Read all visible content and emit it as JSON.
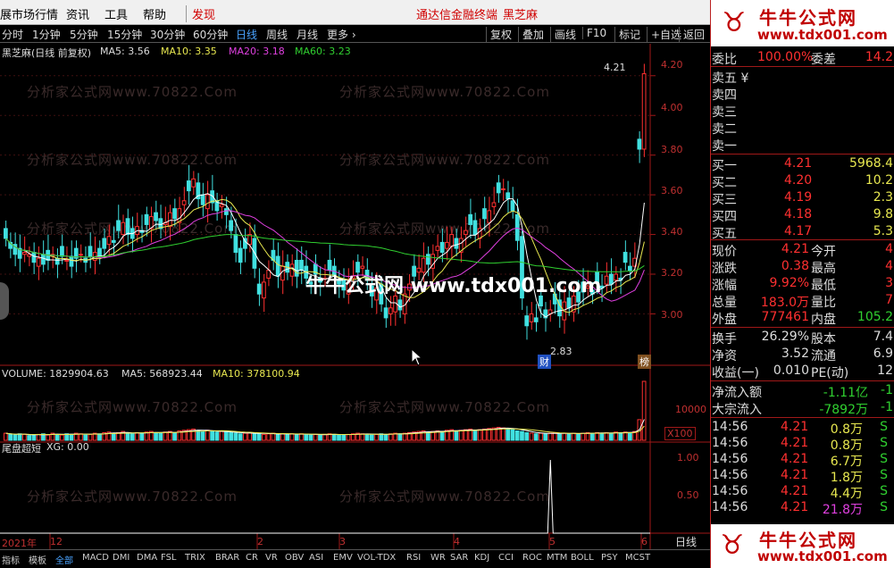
{
  "menu": {
    "items": [
      "展市场行情",
      "资讯",
      "工具",
      "帮助"
    ],
    "discover": "发现",
    "app_title": "通达信金融终端",
    "stock_name": "黑芝麻",
    "win_buttons": [
      "▫",
      "—",
      "□",
      "✕"
    ]
  },
  "toolbar": {
    "periods": [
      "分时",
      "1分钟",
      "5分钟",
      "15分钟",
      "30分钟",
      "60分钟",
      "日线",
      "周线",
      "月线",
      "更多 ›"
    ],
    "right_buttons": [
      "复权",
      "叠加",
      "画线",
      "F10",
      "标记",
      "+自选",
      "返回"
    ]
  },
  "price_chart": {
    "label_name": "黑芝麻(日线 前复权)",
    "ma5": "MA5: 3.56",
    "ma10": "MA10: 3.35",
    "ma20": "MA20: 3.18",
    "ma60": "MA60: 3.23",
    "high_label": "4.21",
    "low_label": "2.83",
    "cai_label": "财",
    "bang_label": "榜",
    "y_ticks": [
      "4.20",
      "4.00",
      "3.80",
      "3.60",
      "3.40",
      "3.20",
      "3.00"
    ]
  },
  "volume_chart": {
    "label": "VOLUME: 1829904.63",
    "ma5": "MA5: 568923.44",
    "ma10": "MA10: 378100.94",
    "tick": "10000",
    "unit": "X100"
  },
  "indicator": {
    "name": "尾盘超短",
    "xg": "XG: 0.00",
    "ticks": [
      "1.00",
      "0.50"
    ]
  },
  "date_axis": {
    "year": "2021年",
    "labels": [
      "12",
      "2",
      "3",
      "4",
      "5",
      "6"
    ]
  },
  "watermark": "分析家公式网www.70822.Com",
  "overlay": "牛牛公式网 www.tdx001.com",
  "bottom_tabs": [
    "指标",
    "模板",
    "全部",
    "MACD",
    "DMI",
    "DMA",
    "FSL",
    "TRIX",
    "BRAR",
    "CR",
    "VR",
    "OBV",
    "ASI",
    "EMV",
    "VOL-TDX",
    "RSI",
    "WR",
    "SAR",
    "KDJ",
    "CCI",
    "ROC",
    "MTM",
    "BOLL",
    "PSY",
    "MCST"
  ],
  "bottom_right": "日线",
  "banner": {
    "title": "牛牛公式网",
    "url": "www.tdx001.com"
  },
  "quote": {
    "weibi_label": "委比",
    "weibi": "100.00%",
    "weicha_label": "委差",
    "weicha": "14.2",
    "sells": [
      {
        "label": "卖五",
        "mark": "¥"
      },
      {
        "label": "卖四"
      },
      {
        "label": "卖三"
      },
      {
        "label": "卖二"
      },
      {
        "label": "卖一"
      }
    ],
    "buys": [
      {
        "label": "买一",
        "price": "4.21",
        "vol": "5968.4"
      },
      {
        "label": "买二",
        "price": "4.20",
        "vol": "10.2"
      },
      {
        "label": "买三",
        "price": "4.19",
        "vol": "2.3"
      },
      {
        "label": "买四",
        "price": "4.18",
        "vol": "9.8"
      },
      {
        "label": "买五",
        "price": "4.17",
        "vol": "5.3"
      }
    ],
    "stats": [
      {
        "l1": "现价",
        "v1": "4.21",
        "l2": "今开",
        "v2": "4"
      },
      {
        "l1": "涨跌",
        "v1": "0.38",
        "l2": "最高",
        "v2": "4"
      },
      {
        "l1": "涨幅",
        "v1": "9.92%",
        "l2": "最低",
        "v2": "3"
      },
      {
        "l1": "总量",
        "v1": "183.0万",
        "l2": "量比",
        "v2": "7"
      },
      {
        "l1": "外盘",
        "v1": "777461",
        "l2": "内盘",
        "v2": "105.2"
      }
    ],
    "stats2": [
      {
        "l1": "换手",
        "v1": "26.29%",
        "l2": "股本",
        "v2": "7.4"
      },
      {
        "l1": "净资",
        "v1": "3.52",
        "l2": "流通",
        "v2": "6.9"
      },
      {
        "l1": "收益(一)",
        "v1": "0.010",
        "l2": "PE(动)",
        "v2": "12"
      }
    ],
    "flows": [
      {
        "label": "净流入额",
        "value": "-1.11亿",
        "extra": "-1"
      },
      {
        "label": "大宗流入",
        "value": "-7892",
        "unit": "万",
        "extra": "-1"
      }
    ],
    "ticks": [
      {
        "time": "14:56",
        "price": "4.21",
        "vol": "0.8万",
        "side": "S"
      },
      {
        "time": "14:56",
        "price": "4.21",
        "vol": "0.8万",
        "side": "S"
      },
      {
        "time": "14:56",
        "price": "4.21",
        "vol": "6.7万",
        "side": "S"
      },
      {
        "time": "14:56",
        "price": "4.21",
        "vol": "1.8万",
        "side": "S"
      },
      {
        "time": "14:56",
        "price": "4.21",
        "vol": "4.4万",
        "side": "S"
      },
      {
        "time": "14:56",
        "price": "4.21",
        "vol": "21.8万",
        "side": "S"
      }
    ]
  },
  "chart_data": {
    "type": "candlestick",
    "ylim": [
      2.75,
      4.28
    ],
    "closes": [
      3.38,
      3.33,
      3.3,
      3.28,
      3.31,
      3.3,
      3.26,
      3.28,
      3.25,
      3.27,
      3.3,
      3.25,
      3.29,
      3.27,
      3.24,
      3.28,
      3.3,
      3.26,
      3.29,
      3.31,
      3.29,
      3.33,
      3.39,
      3.36,
      3.42,
      3.46,
      3.4,
      3.38,
      3.44,
      3.41,
      3.45,
      3.49,
      3.47,
      3.43,
      3.46,
      3.51,
      3.48,
      3.53,
      3.57,
      3.62,
      3.68,
      3.58,
      3.55,
      3.6,
      3.56,
      3.52,
      3.55,
      3.5,
      3.42,
      3.31,
      3.26,
      3.33,
      3.4,
      3.23,
      3.1,
      3.16,
      3.22,
      3.27,
      3.19,
      3.24,
      3.21,
      3.25,
      3.19,
      3.22,
      3.18,
      3.15,
      3.2,
      3.16,
      3.18,
      3.22,
      3.19,
      3.15,
      3.12,
      3.16,
      3.19,
      3.21,
      3.24,
      3.17,
      3.09,
      3.13,
      3.05,
      2.98,
      3.03,
      3.09,
      3.02,
      3.1,
      3.15,
      3.19,
      3.23,
      3.28,
      3.25,
      3.3,
      3.34,
      3.31,
      3.36,
      3.4,
      3.33,
      3.38,
      3.42,
      3.45,
      3.4,
      3.43,
      3.48,
      3.52,
      3.56,
      3.61,
      3.63,
      3.58,
      3.52,
      3.37,
      3.08,
      2.94,
      3.0,
      2.96,
      3.04,
      2.98,
      3.02,
      3.05,
      2.99,
      3.06,
      3.03,
      3.09,
      3.06,
      3.11,
      3.14,
      3.1,
      3.16,
      3.13,
      3.19,
      3.15,
      3.2,
      3.17,
      3.26,
      3.22,
      3.28,
      3.83,
      4.21
    ],
    "volumes": [
      0.12,
      0.1,
      0.09,
      0.11,
      0.1,
      0.08,
      0.09,
      0.1,
      0.11,
      0.09,
      0.12,
      0.1,
      0.09,
      0.11,
      0.1,
      0.12,
      0.11,
      0.09,
      0.1,
      0.12,
      0.11,
      0.13,
      0.14,
      0.12,
      0.13,
      0.15,
      0.12,
      0.11,
      0.13,
      0.12,
      0.14,
      0.15,
      0.13,
      0.12,
      0.14,
      0.15,
      0.13,
      0.16,
      0.17,
      0.18,
      0.19,
      0.16,
      0.15,
      0.17,
      0.15,
      0.14,
      0.15,
      0.14,
      0.13,
      0.12,
      0.11,
      0.12,
      0.13,
      0.12,
      0.11,
      0.1,
      0.11,
      0.12,
      0.1,
      0.11,
      0.1,
      0.11,
      0.1,
      0.11,
      0.1,
      0.09,
      0.1,
      0.09,
      0.1,
      0.11,
      0.1,
      0.09,
      0.09,
      0.1,
      0.11,
      0.12,
      0.11,
      0.1,
      0.09,
      0.1,
      0.11,
      0.1,
      0.11,
      0.12,
      0.11,
      0.12,
      0.13,
      0.14,
      0.15,
      0.16,
      0.14,
      0.15,
      0.16,
      0.15,
      0.17,
      0.18,
      0.16,
      0.17,
      0.18,
      0.19,
      0.17,
      0.18,
      0.19,
      0.2,
      0.21,
      0.22,
      0.21,
      0.19,
      0.18,
      0.16,
      0.15,
      0.13,
      0.12,
      0.11,
      0.12,
      0.11,
      0.12,
      0.13,
      0.11,
      0.12,
      0.11,
      0.12,
      0.11,
      0.12,
      0.13,
      0.12,
      0.13,
      0.12,
      0.13,
      0.12,
      0.14,
      0.13,
      0.14,
      0.13,
      0.15,
      0.35,
      1.0
    ],
    "signal_index": 116
  }
}
